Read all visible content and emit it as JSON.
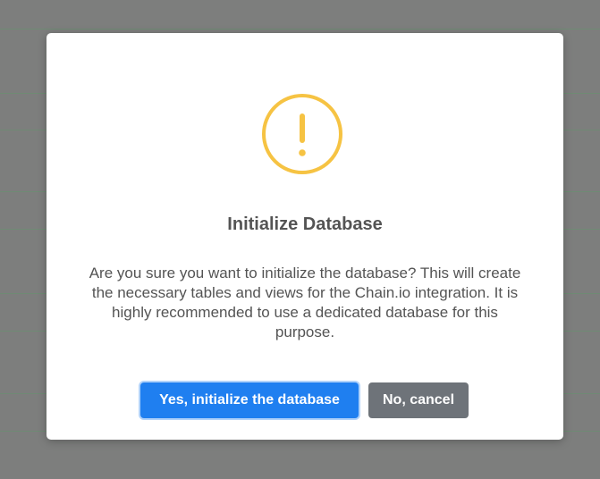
{
  "dialog": {
    "icon": "exclamation-warning-icon",
    "title": "Initialize Database",
    "message": "Are you sure you want to initialize the database? This will create the necessary tables and views for the Chain.io integration. It is highly recommended to use a dedicated database for this purpose.",
    "confirm_label": "Yes, initialize the database",
    "cancel_label": "No, cancel"
  },
  "colors": {
    "backdrop": "#7d7e7d",
    "warning": "#f6c343",
    "confirm": "#1f7ff0",
    "cancel": "#6e7379",
    "text": "#545454"
  }
}
